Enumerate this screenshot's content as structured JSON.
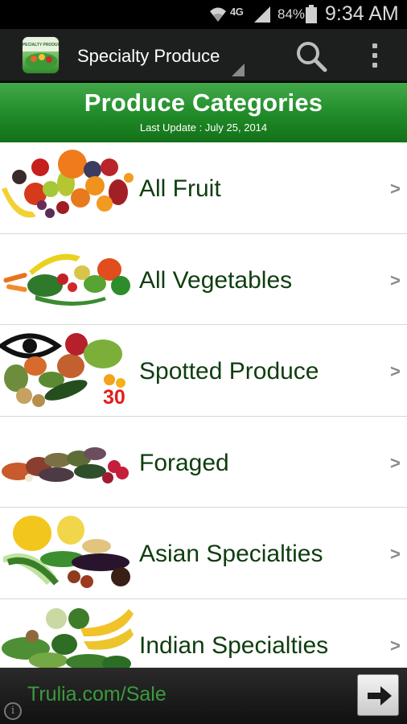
{
  "status_bar": {
    "network_type": "4G",
    "battery_percent": "84%",
    "time": "9:34 AM",
    "icons": [
      "wifi-icon",
      "signal-icon",
      "battery-icon"
    ]
  },
  "action_bar": {
    "app_title": "Specialty Produce",
    "logo_text": "SPECIALTY PRODUCE",
    "icons": [
      "app-logo-icon",
      "spinner-dropdown-icon",
      "search-icon",
      "overflow-menu-icon"
    ]
  },
  "header": {
    "title": "Produce Categories",
    "last_update": "Last Update : July 25, 2014",
    "color": "#1f8a27"
  },
  "categories": [
    {
      "label": "All Fruit",
      "image": "fruit-image",
      "chevron": ">"
    },
    {
      "label": "All Vegetables",
      "image": "vegetables-image",
      "chevron": ">"
    },
    {
      "label": "Spotted Produce",
      "image": "spotted-produce-image",
      "chevron": ">",
      "badge": "30"
    },
    {
      "label": "Foraged",
      "image": "foraged-image",
      "chevron": ">"
    },
    {
      "label": "Asian Specialties",
      "image": "asian-specialties-image",
      "chevron": ">"
    },
    {
      "label": "Indian Specialties",
      "image": "indian-specialties-image",
      "chevron": ">"
    }
  ],
  "ad": {
    "text": "Trulia.com/Sale",
    "info_glyph": "i",
    "icons": [
      "arrow-right-icon",
      "info-icon"
    ],
    "text_color": "#3c9b3e"
  }
}
